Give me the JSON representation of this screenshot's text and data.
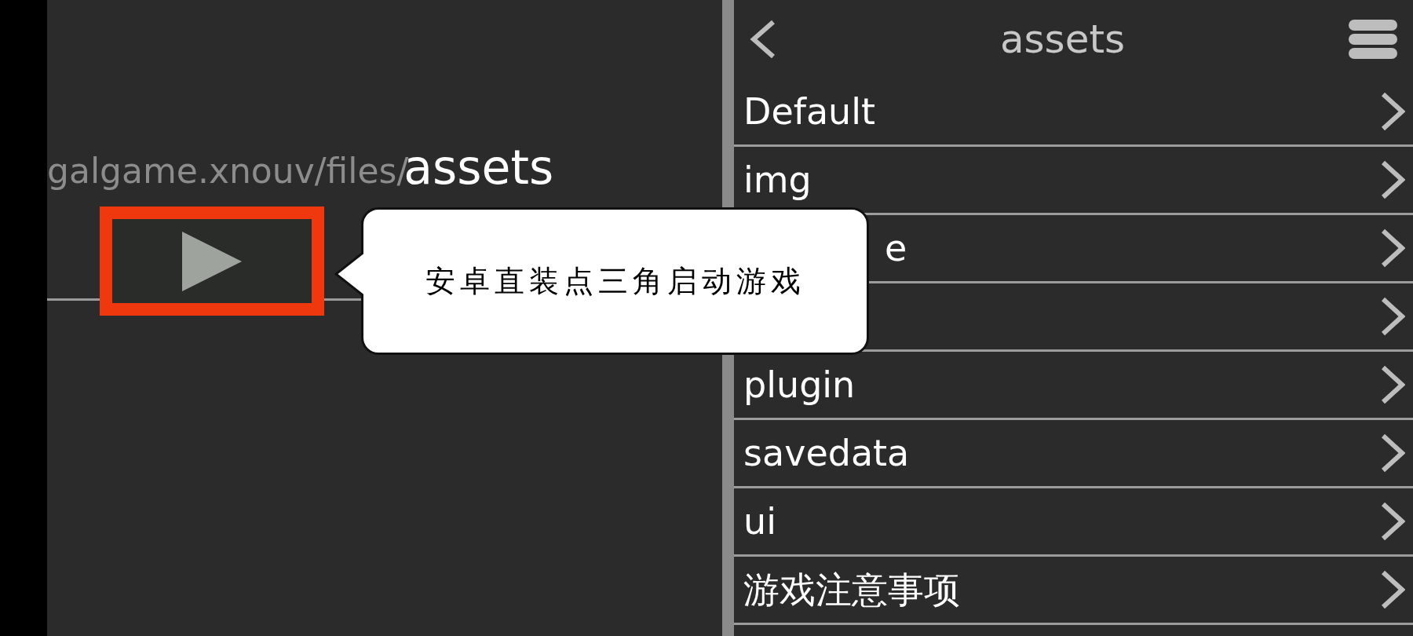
{
  "left_panel": {
    "path_text": "galgame.xnouv/files/",
    "folder_name": "assets",
    "play_button": {
      "highlighted": true
    }
  },
  "tooltip": {
    "text": "安卓直装点三角启动游戏"
  },
  "browser": {
    "title": "assets",
    "items": [
      {
        "kind": "folder",
        "label": "Default"
      },
      {
        "kind": "folder",
        "label": "img"
      },
      {
        "kind": "partial",
        "label": "e"
      },
      {
        "kind": "hidden"
      },
      {
        "kind": "folder",
        "label": "plugin"
      },
      {
        "kind": "folder",
        "label": "savedata"
      },
      {
        "kind": "folder",
        "label": "ui"
      },
      {
        "kind": "folder",
        "label": "游戏注意事项"
      }
    ]
  }
}
